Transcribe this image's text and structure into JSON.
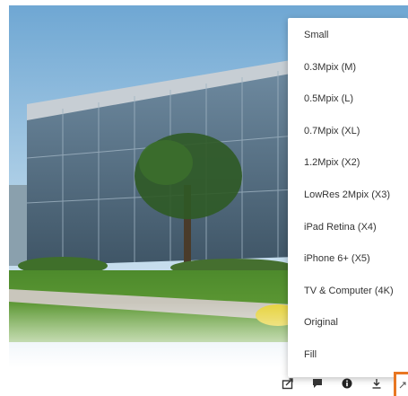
{
  "menu": {
    "items": [
      {
        "label": "Small"
      },
      {
        "label": "0.3Mpix (M)"
      },
      {
        "label": "0.5Mpix (L)"
      },
      {
        "label": "0.7Mpix (XL)"
      },
      {
        "label": "1.2Mpix (X2)"
      },
      {
        "label": "LowRes 2Mpix (X3)"
      },
      {
        "label": "iPad Retina (X4)"
      },
      {
        "label": "iPhone 6+ (X5)"
      },
      {
        "label": "TV & Computer (4K)"
      },
      {
        "label": "Original"
      },
      {
        "label": "Fill"
      }
    ]
  },
  "toolbar": {
    "icons": [
      "share-icon",
      "comment-icon",
      "info-icon",
      "download-icon",
      "photo-sizes-icon"
    ],
    "accent_color": "#e87722"
  }
}
